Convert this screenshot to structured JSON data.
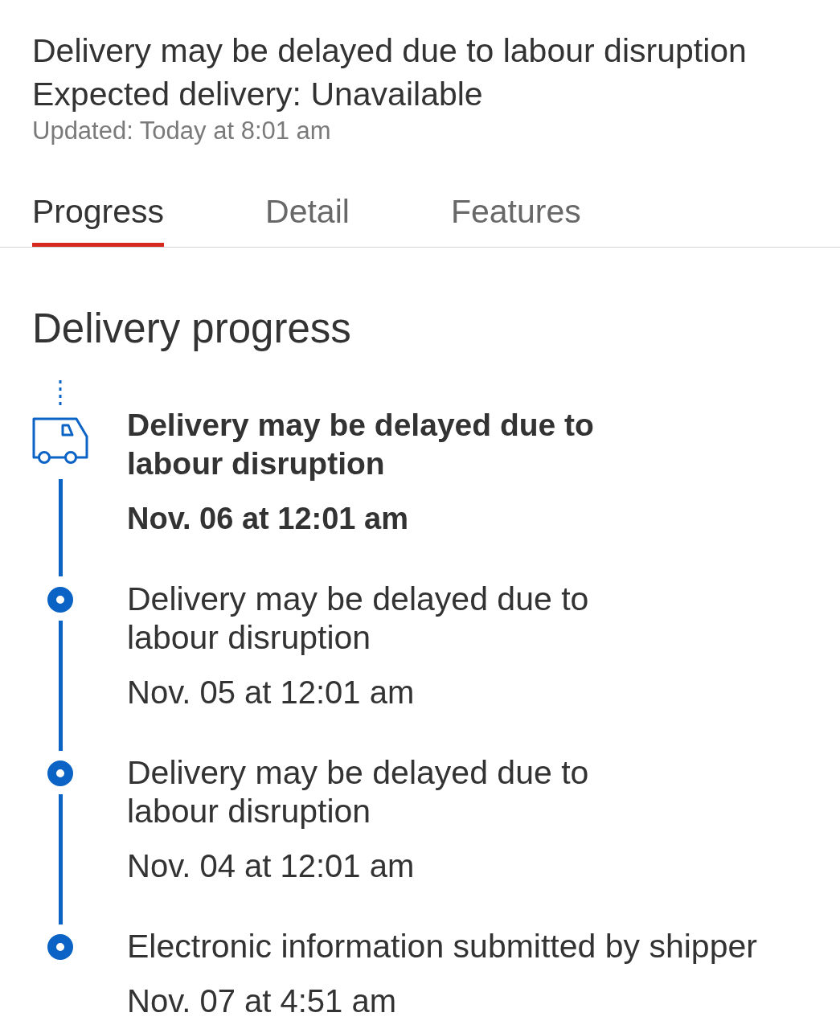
{
  "status": {
    "message": "Delivery may be delayed due to labour disruption",
    "expected_delivery": "Expected delivery: Unavailable",
    "updated": "Updated: Today at 8:01 am"
  },
  "tabs": [
    {
      "label": "Progress",
      "selected": true
    },
    {
      "label": "Detail",
      "selected": false
    },
    {
      "label": "Features",
      "selected": false
    }
  ],
  "progress": {
    "heading": "Delivery progress",
    "events": [
      {
        "kind": "current",
        "title": "Delivery may be delayed due to\nlabour disruption",
        "time": "Nov. 06 at 12:01 am"
      },
      {
        "kind": "past",
        "title": "Delivery may be delayed due to\nlabour disruption",
        "time": "Nov. 05 at 12:01 am"
      },
      {
        "kind": "past",
        "title": "Delivery may be delayed due to\nlabour disruption",
        "time": "Nov. 04 at 12:01 am"
      },
      {
        "kind": "past",
        "title": "Electronic information submitted by shipper",
        "time": "Nov. 07 at 4:51 am"
      }
    ]
  }
}
